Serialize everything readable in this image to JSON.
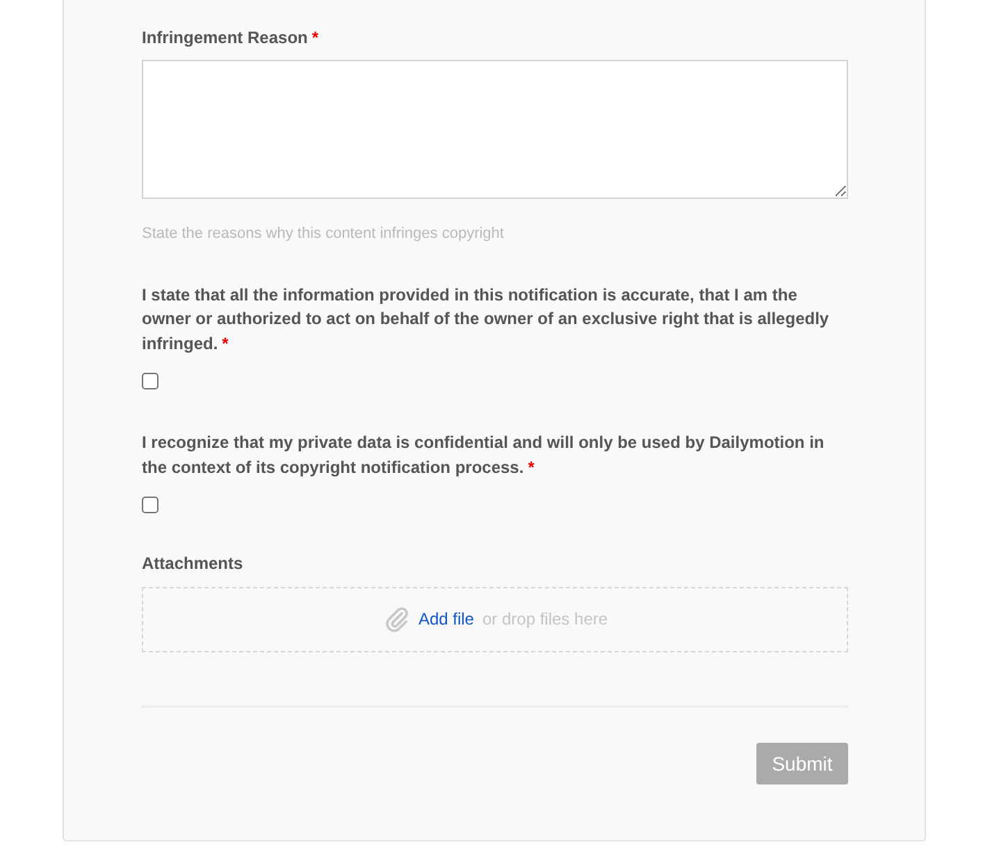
{
  "form": {
    "reason": {
      "label": "Infringement Reason",
      "required_mark": "*",
      "hint": "State the reasons why this content infringes copyright"
    },
    "consents": [
      {
        "text": "I state that all the information provided in this notification is accurate, that I am the owner or authorized to act on behalf of the owner of an exclusive right that is allegedly infringed.",
        "required_mark": "*",
        "checked": false
      },
      {
        "text": "I recognize that my private data is confidential and will only be used by Dailymotion in the context of its copyright notification process.",
        "required_mark": "*",
        "checked": false
      }
    ],
    "attachments": {
      "label": "Attachments",
      "link": "Add file",
      "drop_text": "or drop files here"
    },
    "submit": {
      "label": "Submit",
      "disabled": true
    }
  }
}
